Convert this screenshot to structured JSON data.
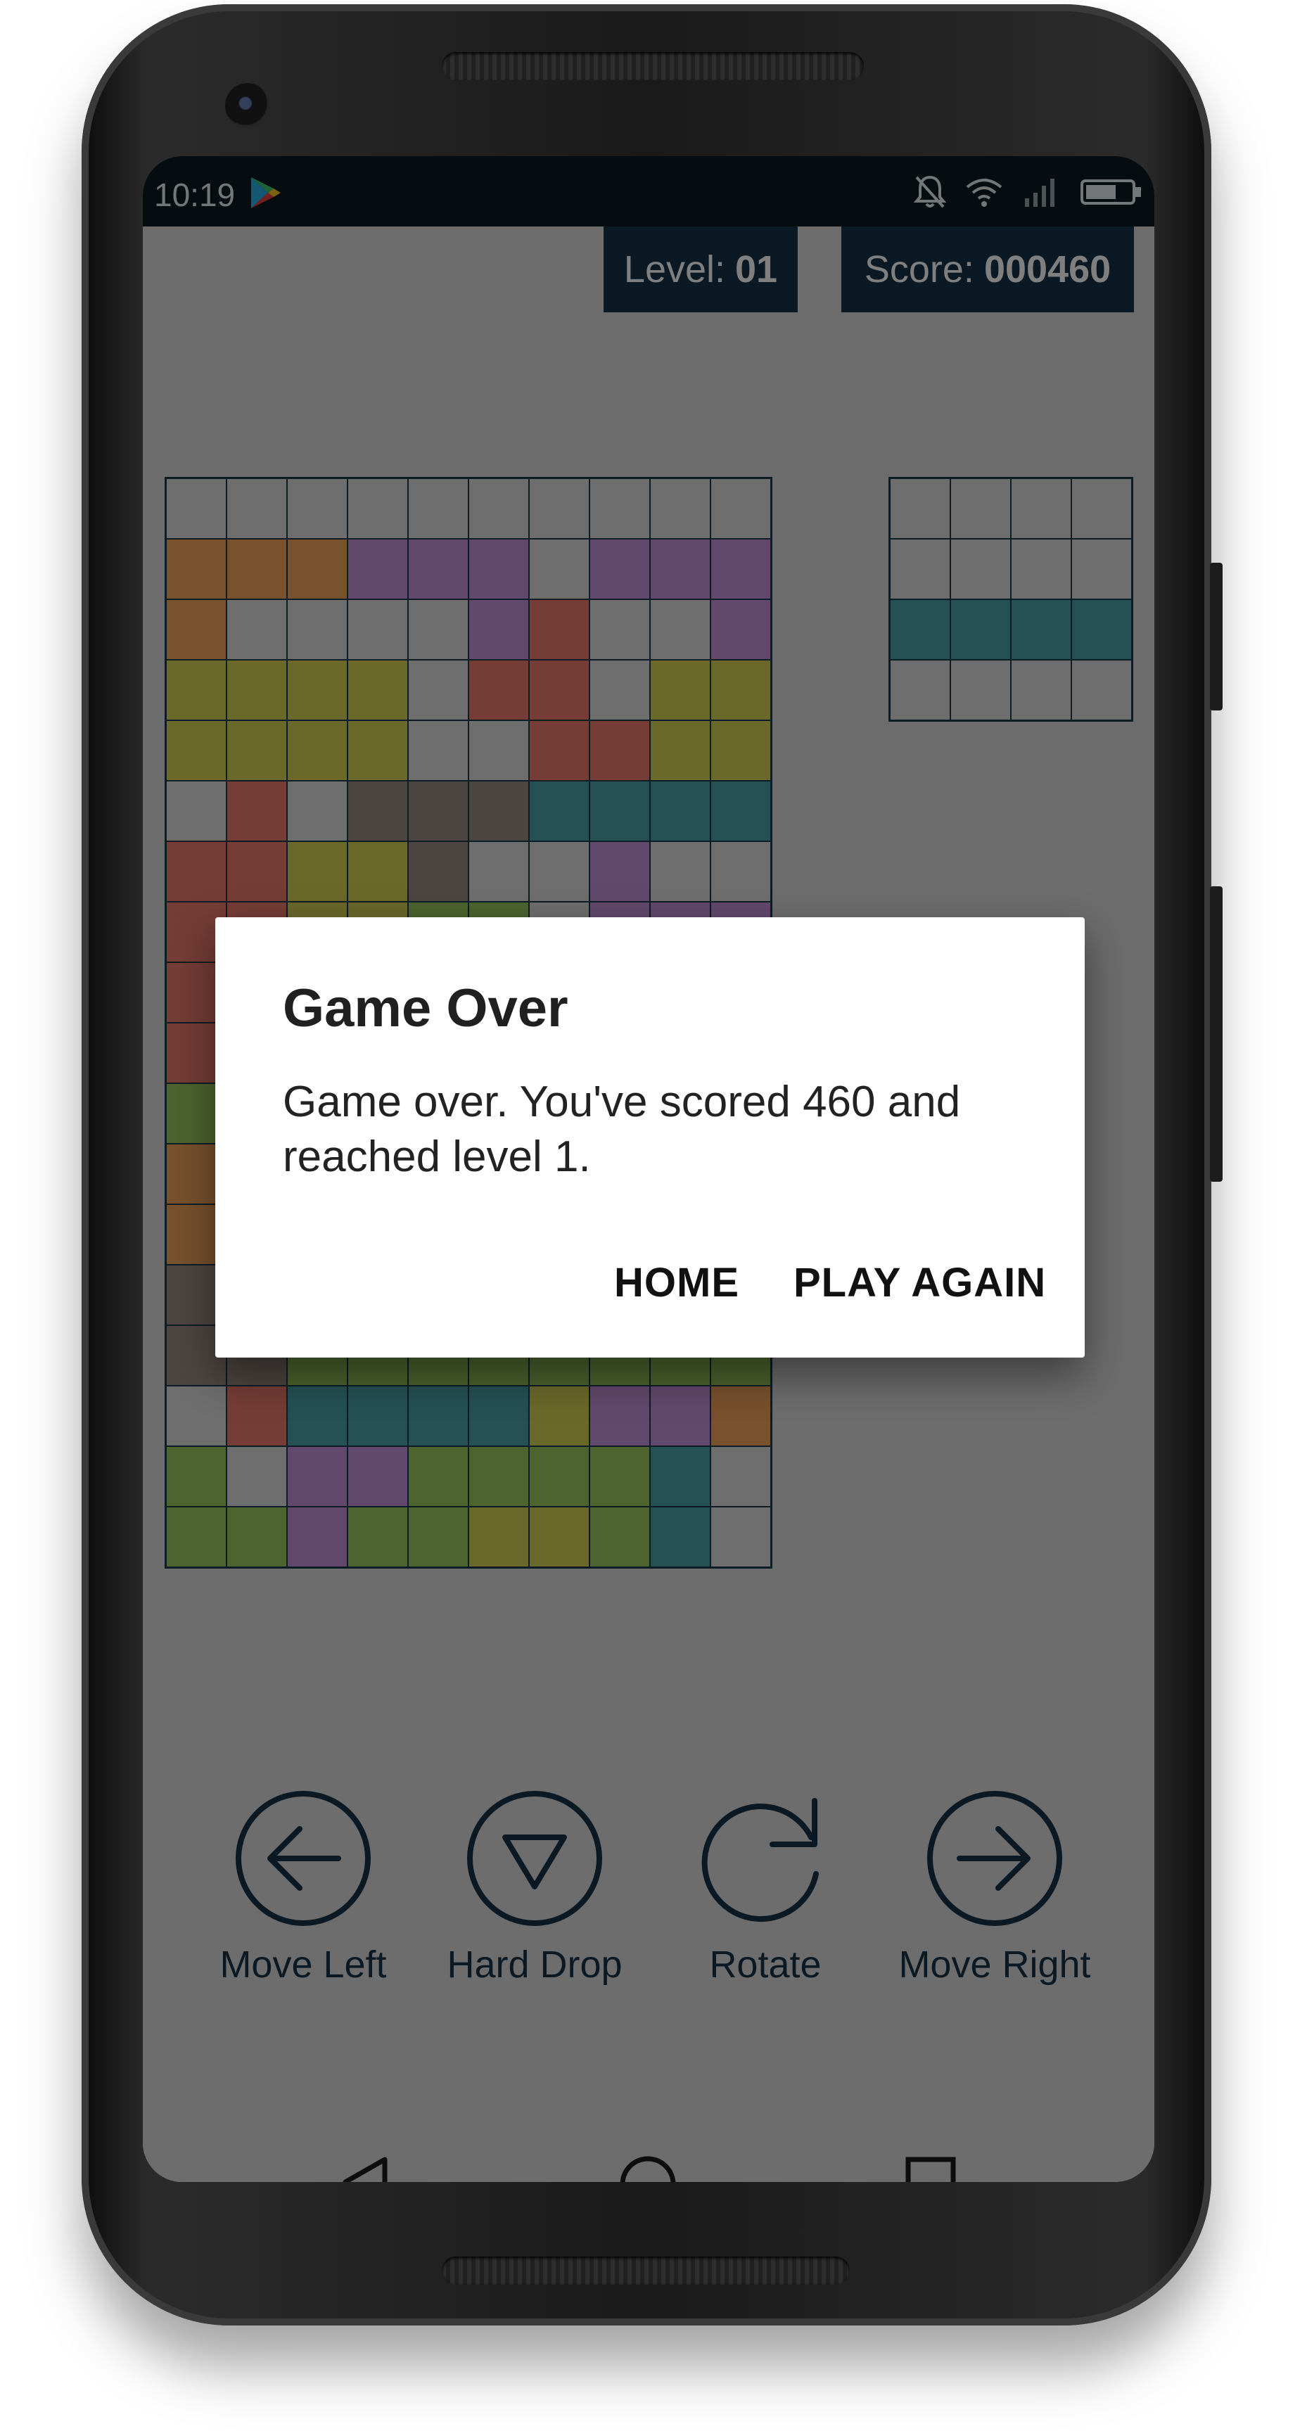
{
  "status_bar": {
    "time": "10:19",
    "icons": [
      "play-store-icon",
      "notifications-off-icon",
      "wifi-icon",
      "cell-signal-icon",
      "battery-icon"
    ]
  },
  "hud": {
    "level_label": "Level:",
    "level_value": "01",
    "score_label": "Score:",
    "score_value": "000460"
  },
  "colors": {
    "O": "#f0a35a",
    "P": "#c490d8",
    "X": "#ea7a6a",
    "Y": "#d6d056",
    "T": "#4aa3a9",
    "B": "#9a8a82",
    "G": "#9ac85f",
    "empty": "#dcdcdc",
    "hud_bg": "#143347",
    "statusbar_bg": "#0d1b22"
  },
  "board": {
    "rows": [
      "..........",
      "OOOPPP.PPP",
      "O....PX..P",
      "YYYY.XX.YY",
      "YYYY..XXYY",
      ".X.BBBTTTT",
      "XXYYB..P..",
      "XXYYGG.PPP",
      "X.GGG.TTTT",
      "X.GGG.TTTT",
      "GGGGGGGGGG",
      "OOGGGGGGGG",
      "OOGGGGGGGG",
      "BBGGGGGGGG",
      "BBGGGGGGGG",
      ".XTTTTYPPO",
      "G.PPGGGGT.",
      "GGPGGYYGT."
    ]
  },
  "preview": {
    "rows": [
      "....",
      "....",
      "TTTT",
      "...."
    ]
  },
  "controls": [
    {
      "label": "Move Left",
      "icon": "arrow-left-circle-icon"
    },
    {
      "label": "Hard Drop",
      "icon": "triangle-down-circle-icon"
    },
    {
      "label": "Rotate",
      "icon": "rotate-clockwise-icon"
    },
    {
      "label": "Move Right",
      "icon": "arrow-right-circle-icon"
    }
  ],
  "dialog": {
    "title": "Game Over",
    "message": "Game over. You've scored 460 and reached level 1.",
    "home_label": "HOME",
    "play_again_label": "PLAY AGAIN"
  },
  "nav_bar": {
    "icons": [
      "back-triangle-icon",
      "home-circle-icon",
      "recents-square-icon"
    ]
  }
}
